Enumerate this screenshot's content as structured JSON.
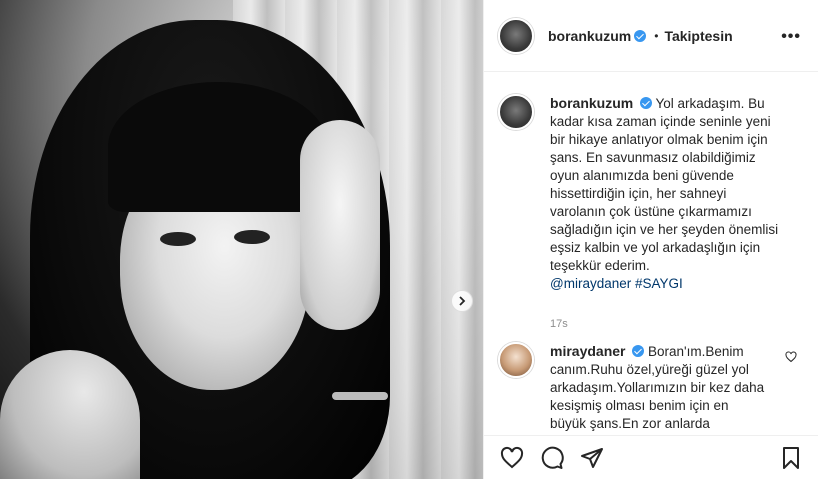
{
  "post": {
    "username": "borankuzum",
    "separator": "•",
    "follow_status": "Takiptesin",
    "more_label": "•••"
  },
  "caption": {
    "username": "borankuzum",
    "text": "Yol arkadaşım. Bu kadar kısa zaman içinde seninle yeni bir hikaye anlatıyor olmak benim için şans. En savunmasız olabildiğimiz oyun alanımızda beni güvende hissettirdiğin için, her sahneyi varolanın çok üstüne çıkarmamızı sağladığın için ve her şeyden önemlisi eşsiz kalbin ve yol arkadaşlığın için teşekkür ederim.",
    "mention": "@miraydaner",
    "hashtag": "#SAYGI",
    "time": "17s"
  },
  "reply": {
    "username": "miraydaner",
    "text": "Boran'ım.Benim canım.Ruhu özel,yüreği güzel yol arkadaşım.Yollarımızın bir kez daha kesişmiş olması benim için en büyük şans.En zor anlarda"
  },
  "icons": {
    "verified": "verified-badge-icon",
    "like": "heart-icon",
    "comment": "comment-icon",
    "share": "share-icon",
    "save": "bookmark-icon",
    "next": "chevron-right-icon"
  },
  "colors": {
    "verified": "#3897f0",
    "link": "#00376b",
    "muted": "#8e8e8e",
    "border": "#efefef"
  }
}
